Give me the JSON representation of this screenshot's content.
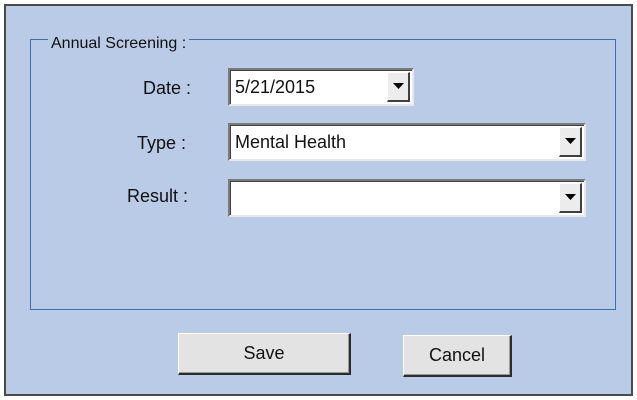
{
  "group": {
    "title": "Annual Screening :"
  },
  "fields": {
    "date": {
      "label": "Date :",
      "value": "5/21/2015"
    },
    "type": {
      "label": "Type :",
      "value": "Mental Health"
    },
    "result": {
      "label": "Result :",
      "value": ""
    }
  },
  "buttons": {
    "save": "Save",
    "cancel": "Cancel"
  },
  "icons": {
    "dropdown": "chevron-down-icon"
  }
}
